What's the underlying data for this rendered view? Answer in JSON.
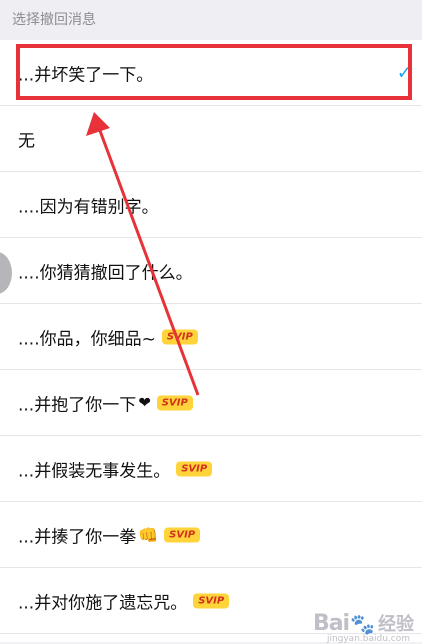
{
  "header": {
    "title": "选择撤回消息"
  },
  "options": [
    {
      "label": "...并坏笑了一下。",
      "selected": true
    },
    {
      "label": "无"
    },
    {
      "label": "....因为有错别字。"
    },
    {
      "label": "....你猜猜撤回了什么。"
    },
    {
      "label": "....你品，你细品~",
      "badge": "SVIP"
    },
    {
      "label": "...并抱了你一下",
      "badge": "SVIP"
    },
    {
      "label": "...并假装无事发生。",
      "badge": "SVIP"
    },
    {
      "label": "...并揍了你一拳",
      "badge": "SVIP"
    },
    {
      "label": "...并对你施了遗忘咒。",
      "badge": "SVIP"
    }
  ],
  "icons": {
    "checkmark": "checkmark-icon",
    "heart": "heart-icon",
    "fist": "fist-icon"
  },
  "colors": {
    "highlight_border": "#e8323a",
    "check": "#1aa3f0",
    "badge_bg": "#ffd43a",
    "badge_text": "#d2311d"
  },
  "watermark": {
    "logo": "Bai",
    "text": "经验",
    "url": "jingyan.baidu.com"
  }
}
